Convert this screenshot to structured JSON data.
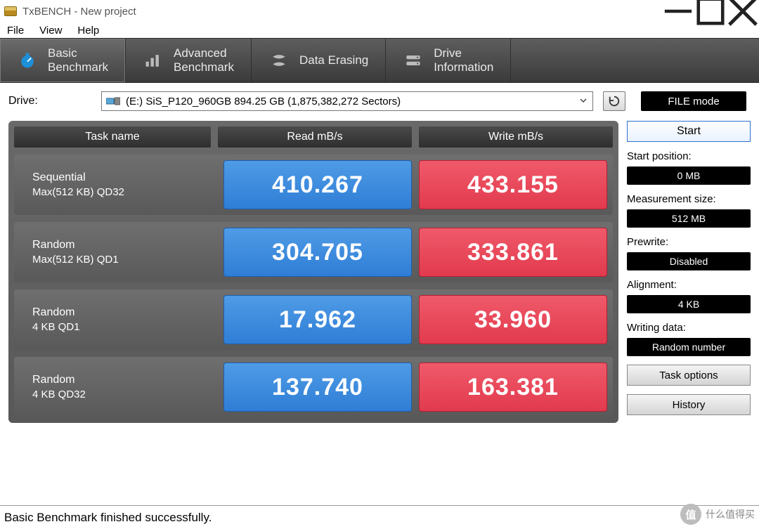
{
  "window": {
    "title": "TxBENCH - New project"
  },
  "menu": {
    "file": "File",
    "view": "View",
    "help": "Help"
  },
  "tabs": {
    "basic": "Basic\nBenchmark",
    "advanced": "Advanced\nBenchmark",
    "erasing": "Data Erasing",
    "driveinfo": "Drive\nInformation"
  },
  "drive": {
    "label": "Drive:",
    "value": "(E:) SiS_P120_960GB  894.25 GB (1,875,382,272 Sectors)",
    "filemode": "FILE mode"
  },
  "headers": {
    "task": "Task name",
    "read": "Read mB/s",
    "write": "Write mB/s"
  },
  "rows": [
    {
      "name1": "Sequential",
      "name2": "Max(512 KB) QD32",
      "read": "410.267",
      "write": "433.155"
    },
    {
      "name1": "Random",
      "name2": "Max(512 KB) QD1",
      "read": "304.705",
      "write": "333.861"
    },
    {
      "name1": "Random",
      "name2": "4 KB QD1",
      "read": "17.962",
      "write": "33.960"
    },
    {
      "name1": "Random",
      "name2": "4 KB QD32",
      "read": "137.740",
      "write": "163.381"
    }
  ],
  "side": {
    "start": "Start",
    "startpos_lbl": "Start position:",
    "startpos_val": "0 MB",
    "msize_lbl": "Measurement size:",
    "msize_val": "512 MB",
    "prewrite_lbl": "Prewrite:",
    "prewrite_val": "Disabled",
    "align_lbl": "Alignment:",
    "align_val": "4 KB",
    "wdata_lbl": "Writing data:",
    "wdata_val": "Random number",
    "taskopt": "Task options",
    "history": "History"
  },
  "status": "Basic Benchmark finished successfully.",
  "watermark": {
    "badge": "值",
    "text": "什么值得买"
  },
  "chart_data": {
    "type": "table",
    "title": "TxBENCH Basic Benchmark",
    "columns": [
      "Task",
      "Read mB/s",
      "Write mB/s"
    ],
    "rows": [
      [
        "Sequential Max(512 KB) QD32",
        410.267,
        433.155
      ],
      [
        "Random Max(512 KB) QD1",
        304.705,
        333.861
      ],
      [
        "Random 4 KB QD1",
        17.962,
        33.96
      ],
      [
        "Random 4 KB QD32",
        137.74,
        163.381
      ]
    ]
  }
}
